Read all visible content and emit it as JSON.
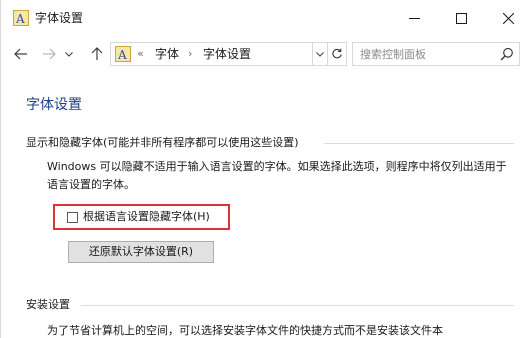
{
  "window": {
    "title": "字体设置",
    "app_icon": "font-icon",
    "controls": {
      "minimize": "minimize-icon",
      "maximize": "maximize-icon",
      "close": "close-icon"
    }
  },
  "nav": {
    "back_icon": "back-arrow-icon",
    "forward_icon": "forward-arrow-icon",
    "recent_icon": "chevron-down-icon",
    "up_icon": "up-arrow-icon",
    "address": {
      "prefix": "«",
      "crumbs": [
        "字体",
        "字体设置"
      ],
      "separator": "›"
    },
    "refresh_icon": "refresh-icon",
    "search": {
      "placeholder": "搜索控制面板",
      "value": ""
    }
  },
  "main": {
    "title": "字体设置",
    "show_hide_section": {
      "heading": "显示和隐藏字体(可能并非所有程序都可以使用这些设置)",
      "description": "Windows 可以隐藏不适用于输入语言设置的字体。如果选择此选项，则程序中将仅列出适用于语言设置的字体。",
      "checkbox_label": "根据语言设置隐藏字体(H)",
      "checkbox_checked": false,
      "restore_button": "还原默认字体设置(R)"
    },
    "install_section": {
      "heading": "安装设置",
      "description": "为了节省计算机上的空间，可以选择安装字体文件的快捷方式而不是安装该文件本"
    }
  },
  "colors": {
    "title_blue": "#1e3f8a",
    "highlight_red": "#d9343a",
    "border_gray": "#d9d9d9"
  }
}
